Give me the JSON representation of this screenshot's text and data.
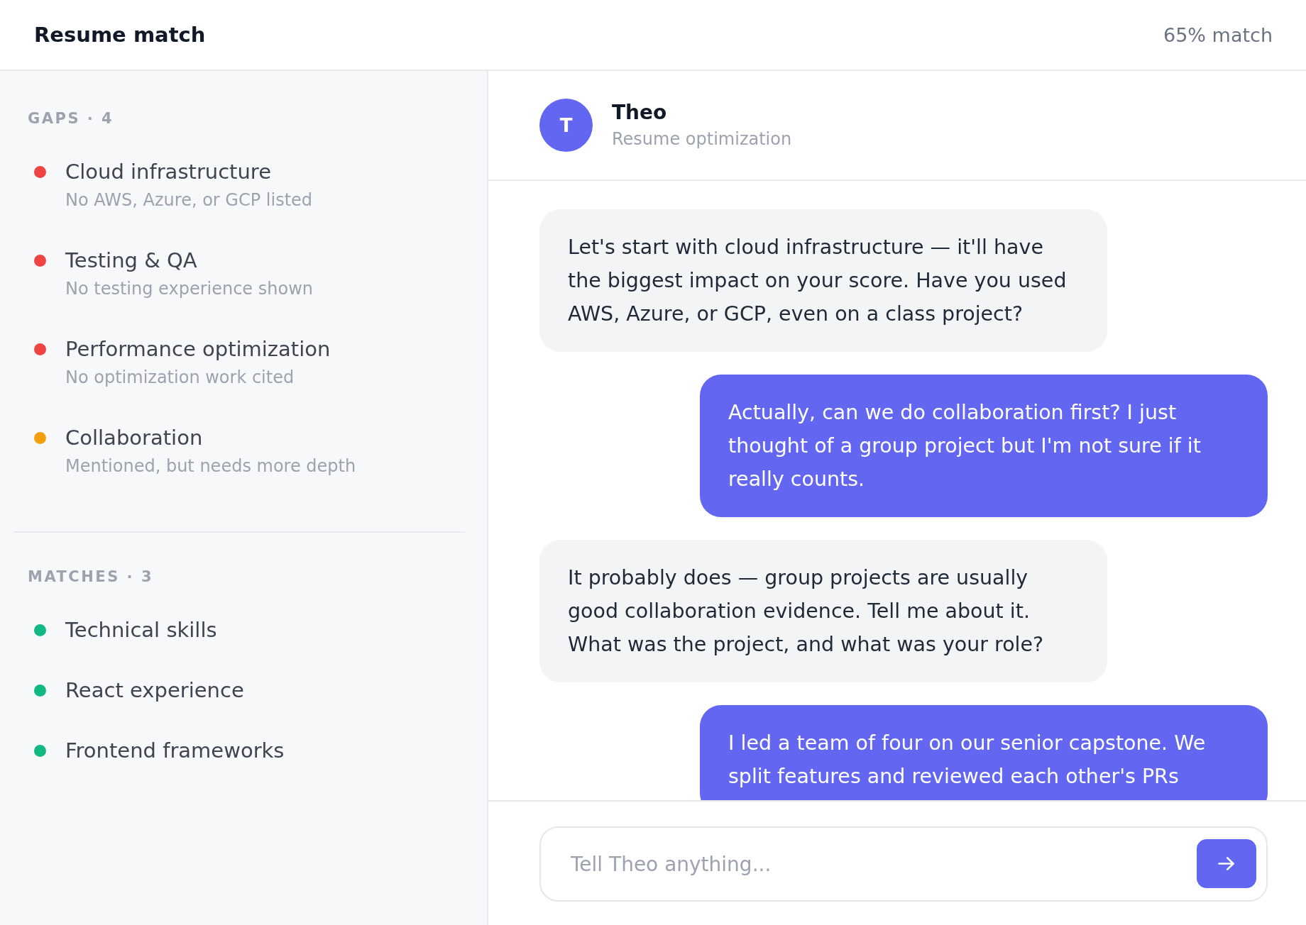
{
  "header": {
    "title": "Resume match",
    "match_score": "65% match"
  },
  "sidebar": {
    "sections": [
      {
        "heading": "GAPS · 4",
        "items": [
          {
            "title": "Cloud infrastructure",
            "detail": "No AWS, Azure, or GCP listed",
            "color": "#ef4444"
          },
          {
            "title": "Testing & QA",
            "detail": "No testing experience shown",
            "color": "#ef4444"
          },
          {
            "title": "Performance optimization",
            "detail": "No optimization work cited",
            "color": "#ef4444"
          },
          {
            "title": "Collaboration",
            "detail": "Mentioned, but needs more depth",
            "color": "#f59e0b"
          }
        ]
      },
      {
        "heading": "MATCHES · 3",
        "items": [
          {
            "title": "Technical skills",
            "color": "#10b981"
          },
          {
            "title": "React experience",
            "color": "#10b981"
          },
          {
            "title": "Frontend frameworks",
            "color": "#10b981"
          }
        ]
      }
    ]
  },
  "chat": {
    "assistant": {
      "initial": "T",
      "name": "Theo",
      "subtitle": "Resume optimization"
    },
    "messages": [
      {
        "kind": "assistant",
        "text": "Let's start with cloud infrastructure — it'll have the biggest impact on your score. Have you used AWS, Azure, or GCP, even on a class project?"
      },
      {
        "kind": "user",
        "text": "Actually, can we do collaboration first? I just thought of a group project but I'm not sure if it really counts."
      },
      {
        "kind": "assistant",
        "text": "It probably does — group projects are usually good collaboration evidence. Tell me about it. What was the project, and what was your role?"
      },
      {
        "kind": "user",
        "text": "I led a team of four on our senior capstone. We split features and reviewed each other's PRs"
      }
    ],
    "composer": {
      "placeholder": "Tell Theo anything..."
    }
  }
}
